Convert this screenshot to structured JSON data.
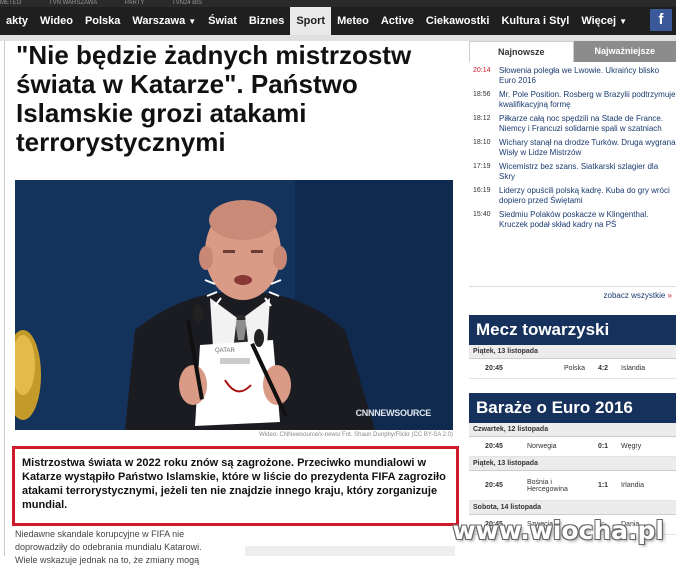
{
  "top_strip": [
    "METEO",
    "TVN WARSZAWA",
    "PARTY",
    "TVN24 BIS"
  ],
  "nav": {
    "items": [
      "akty",
      "Wideo",
      "Polska",
      "Warszawa",
      "Świat",
      "Biznes",
      "Sport",
      "Meteo",
      "Active",
      "Ciekawostki",
      "Kultura i Styl",
      "Więcej"
    ],
    "active": "Sport",
    "fb_label": "f"
  },
  "article": {
    "title": "\"Nie będzie żadnych mistrzostw świata w Katarze\". Państwo Islamskie grozi atakami terrorystycznymi",
    "photo_caption": "Wideo: CNNewsource/x-news/ Fot. Shaun Dunphy/Flickr (CC BY-SA 2.0)",
    "photo_logo": "CNNNEWSOURCE",
    "photo_card_text": "QATAR",
    "lead": "Mistrzostwa świata w 2022 roku znów są zagrożone. Przeciwko mundialowi w Katarze wystąpiło Państwo Islamskie, które w liście do prezydenta FIFA zagroziło atakami terrorystycznymi, jeżeli ten nie znajdzie innego kraju, który zorganizuje mundial.",
    "body_start": "Niedawne skandale korupcyjne w FIFA nie doprowadziły do odebrania mundialu Katarowi. Wiele wskazuje jednak na to, że zmiany mogą"
  },
  "sidebar": {
    "tabs": [
      "Najnowsze",
      "Najważniejsze"
    ],
    "news": [
      {
        "time": "20:14",
        "text": "Słowenia poległa we Lwowie. Ukraińcy blisko Euro 2016",
        "highlight": true
      },
      {
        "time": "18:56",
        "text": "Mr. Pole Position. Rosberg w Brazylii podtrzymuje kwalifikacyjną formę"
      },
      {
        "time": "18:12",
        "text": "Piłkarze całą noc spędzili na Stade de France. Niemcy i Francuzi solidarnie spali w szatniach"
      },
      {
        "time": "18:10",
        "text": "Wichary stanął na drodze Turków. Druga wygrana Wisły w Lidze Mistrzów"
      },
      {
        "time": "17:19",
        "text": "Wicemistrz bez szans. Siatkarski szlagier dla Skry"
      },
      {
        "time": "16:19",
        "text": "Liderzy opuścili polską kadrę. Kuba do gry wróci dopiero przed Świętami"
      },
      {
        "time": "15:40",
        "text": "Siedmiu Polaków poskacze w Klingenthal. Kruczek podał skład kadry na PŚ"
      }
    ],
    "more_label": "zobacz wszystkie",
    "friendly": {
      "title": "Mecz towarzyski",
      "day": "Piątek, 13 listopada",
      "matches": [
        {
          "time": "20:45",
          "home": "Polska",
          "score": "4:2",
          "away": "Islandia"
        }
      ]
    },
    "playoffs": {
      "title": "Baraże o Euro 2016",
      "days": [
        {
          "day": "Czwartek, 12 listopada",
          "matches": [
            {
              "time": "20:45",
              "home": "Norwegia",
              "score": "0:1",
              "away": "Węgry"
            }
          ]
        },
        {
          "day": "Piątek, 13 listopada",
          "matches": [
            {
              "time": "20:45",
              "home": "Bośnia i Hercegowina",
              "score": "1:1",
              "away": "Irlandia"
            }
          ]
        },
        {
          "day": "Sobota, 14 listopada",
          "matches": [
            {
              "time": "20:45",
              "home": "Szwecja",
              "score": "-:-",
              "away": "Dania"
            }
          ]
        }
      ]
    }
  },
  "watermark": "www.wiocha.pl",
  "colors": {
    "nav_bg": "#1f1f1f",
    "accent_red": "#d0192a",
    "sidebar_box": "#16325c",
    "link": "#1a3a6e"
  }
}
